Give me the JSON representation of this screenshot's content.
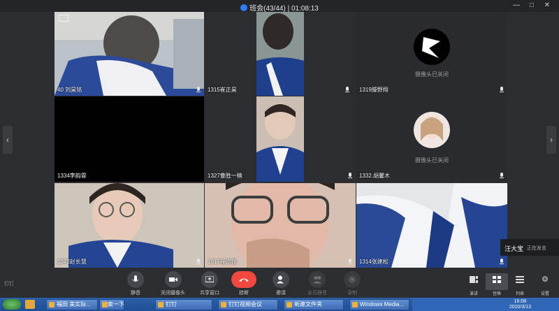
{
  "window": {
    "title": "班会(43/44) | 01:08:13",
    "controls": [
      "—",
      "□",
      "✕"
    ]
  },
  "participants": [
    {
      "name": "40  刘昊铭",
      "camera": "on",
      "bg": "#bcc3c8"
    },
    {
      "name": "1315崔正昊",
      "camera": "on",
      "bg": "#7d8a8c"
    },
    {
      "name": "1319滕野翔",
      "camera": "off",
      "avatar": "logo",
      "status": "摄像头已关闭"
    },
    {
      "name": "1334李韵霏",
      "camera": "on",
      "bg": "#000000"
    },
    {
      "name": "1327曹胜一楠",
      "camera": "on",
      "bg": "#cdbfb2"
    },
    {
      "name": "1332.胡馨木",
      "camera": "off",
      "avatar": "photo",
      "status": "摄像头已关闭"
    },
    {
      "name": "1342赵长慧",
      "camera": "on",
      "bg": "#d0c6bc"
    },
    {
      "name": "1317崔浩铭",
      "camera": "on",
      "bg": "#d8c2b6"
    },
    {
      "name": "1314张建松",
      "camera": "on",
      "bg": "#e1e4ea"
    }
  ],
  "speaker": {
    "name": "汪大宝",
    "status": "正在发言"
  },
  "toolbar": {
    "brand": "钉钉",
    "mute": "静音",
    "camera_off": "关闭摄像头",
    "share": "共享窗口",
    "hangup": "挂断",
    "invite": "邀请",
    "mute_all": "全员静音",
    "record": "录制",
    "layouts": {
      "speech": "演讲",
      "grid": "宫格",
      "list": "列表"
    },
    "settings": "设置"
  },
  "taskbar": {
    "items": [
      "福田 美实际...",
      "搜索一下",
      "钉钉",
      "钉钉视频会议",
      "新建文件夹",
      "Windows Media..."
    ],
    "time": "16:08",
    "date": "2020/3/13"
  },
  "colors": {
    "accent": "#2d7cf6",
    "hangup": "#f0483e",
    "background": "#2b2d30"
  }
}
